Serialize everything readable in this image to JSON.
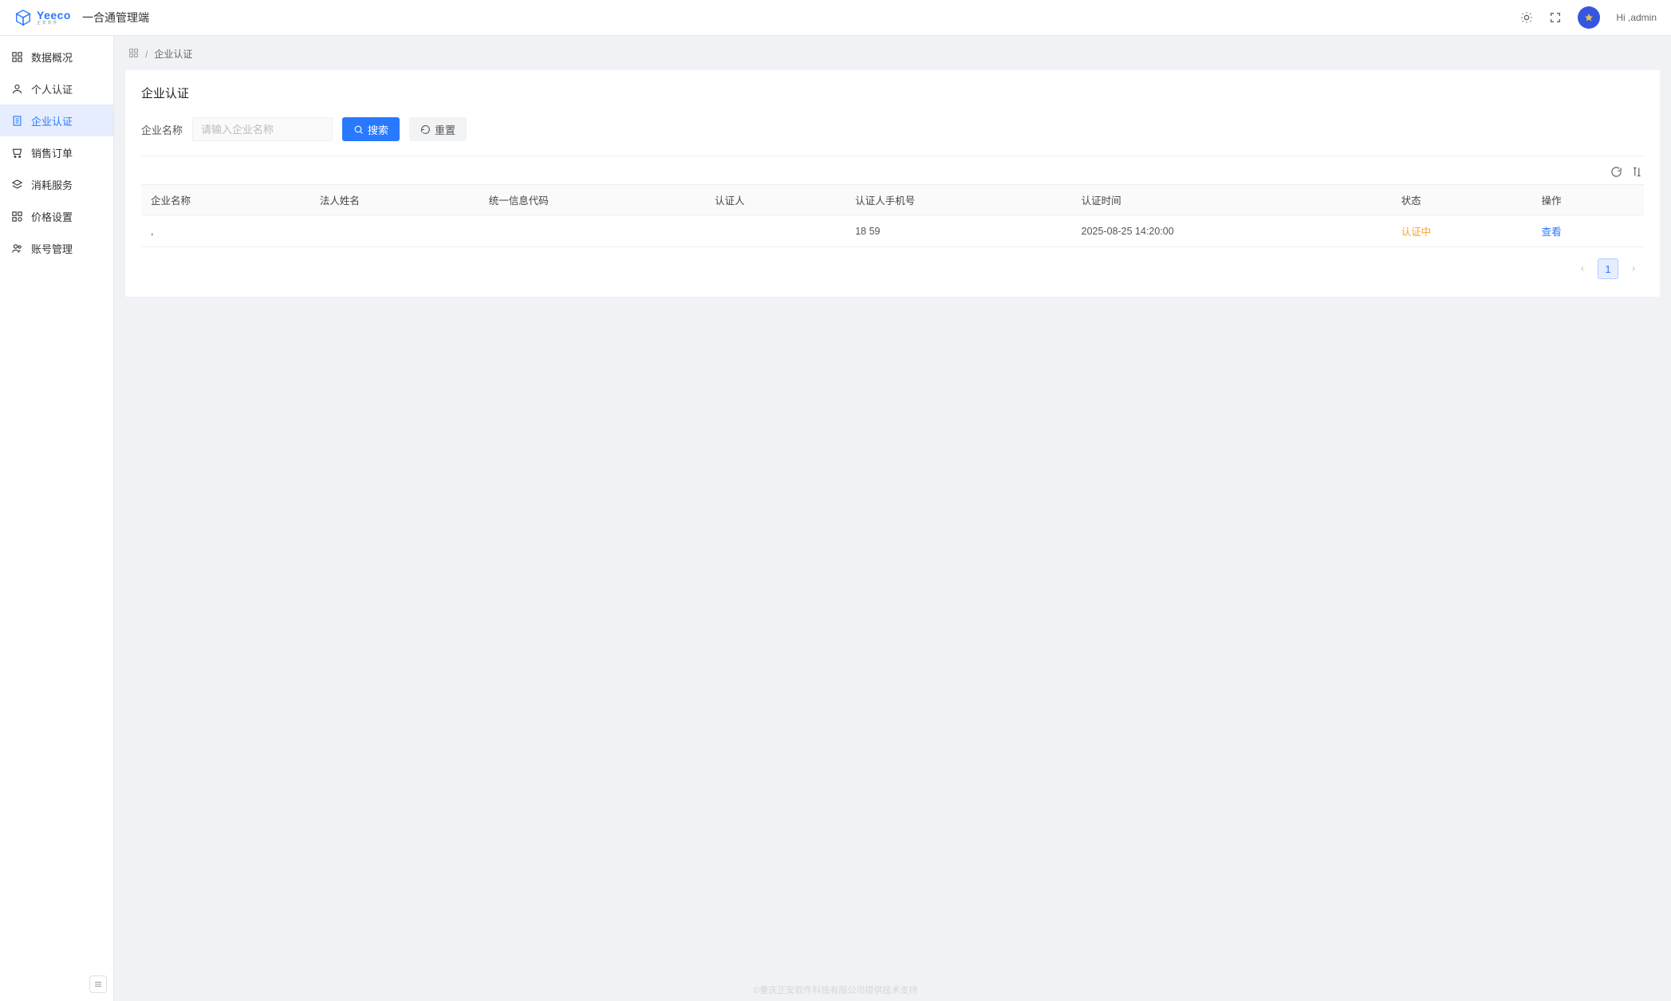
{
  "header": {
    "brand": "Yeeco",
    "brand_sub": "正安软件",
    "app_title": "一合通管理端",
    "user_label": "Hi ,admin"
  },
  "sidebar": {
    "items": [
      {
        "label": "数据概况",
        "icon": "dashboard"
      },
      {
        "label": "个人认证",
        "icon": "user"
      },
      {
        "label": "企业认证",
        "icon": "building",
        "active": true
      },
      {
        "label": "销售订单",
        "icon": "cart"
      },
      {
        "label": "消耗服务",
        "icon": "stack"
      },
      {
        "label": "价格设置",
        "icon": "tag"
      },
      {
        "label": "账号管理",
        "icon": "account"
      }
    ]
  },
  "breadcrumb": {
    "current": "企业认证"
  },
  "page": {
    "title": "企业认证",
    "search_label": "企业名称",
    "search_placeholder": "请输入企业名称",
    "search_button": "搜索",
    "reset_button": "重置"
  },
  "table": {
    "columns": [
      "企业名称",
      "法人姓名",
      "统一信息代码",
      "认证人",
      "认证人手机号",
      "认证时间",
      "状态",
      "操作"
    ],
    "rows": [
      {
        "company": ",",
        "legal": "",
        "code": "",
        "certifier": "",
        "phone": "18        59",
        "time": "2025-08-25 14:20:00",
        "status": "认证中",
        "action": "查看"
      }
    ]
  },
  "pagination": {
    "current": 1
  },
  "footer": "©重庆正安软件科技有限公司提供技术支持",
  "colors": {
    "primary": "#2979ff",
    "warning": "#f5a623"
  }
}
